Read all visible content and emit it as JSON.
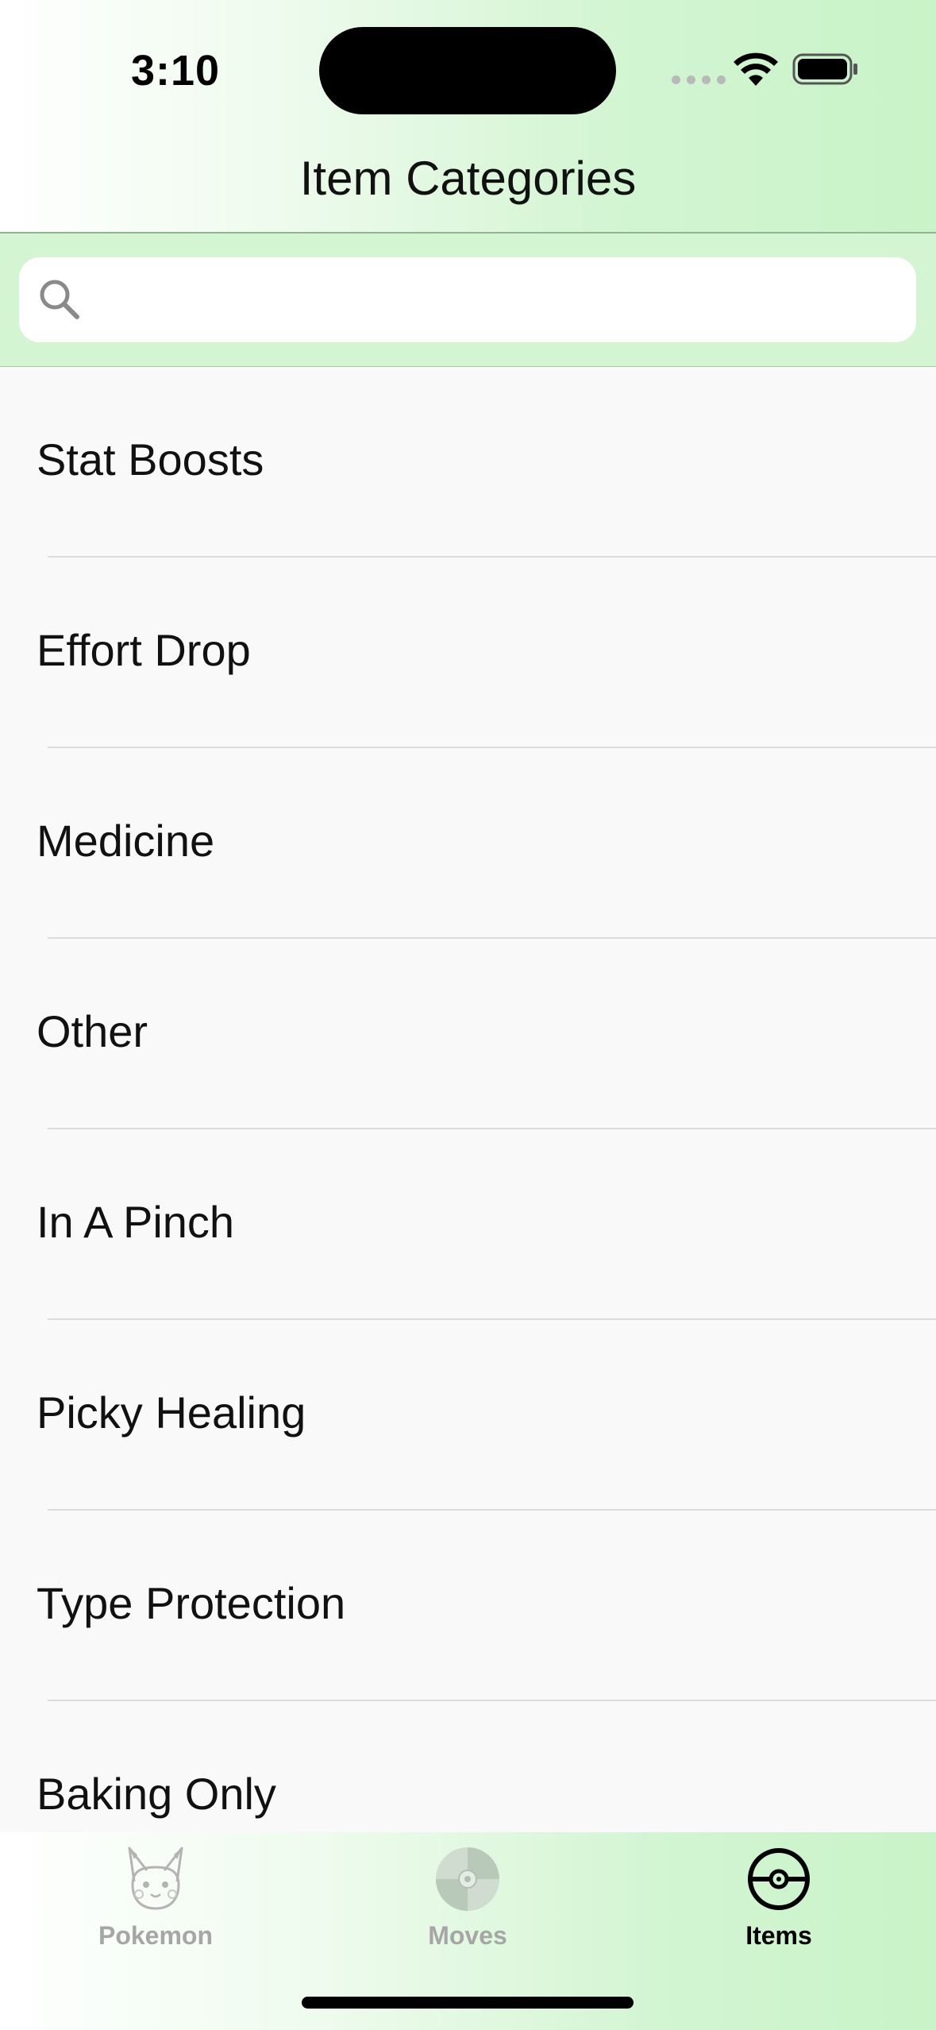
{
  "status_bar": {
    "time": "3:10"
  },
  "nav": {
    "title": "Item Categories"
  },
  "search": {
    "value": "",
    "placeholder": ""
  },
  "categories": [
    {
      "label": "Stat Boosts"
    },
    {
      "label": "Effort Drop"
    },
    {
      "label": "Medicine"
    },
    {
      "label": "Other"
    },
    {
      "label": "In A Pinch"
    },
    {
      "label": "Picky Healing"
    },
    {
      "label": "Type Protection"
    },
    {
      "label": "Baking Only"
    }
  ],
  "tabs": [
    {
      "label": "Pokemon",
      "icon": "pikachu-icon",
      "active": false
    },
    {
      "label": "Moves",
      "icon": "disc-icon",
      "active": false
    },
    {
      "label": "Items",
      "icon": "pokeball-icon",
      "active": true
    }
  ],
  "colors": {
    "header_green": "#d3f5d2",
    "inactive_tab": "#a6a6a6",
    "active_tab": "#000000"
  }
}
